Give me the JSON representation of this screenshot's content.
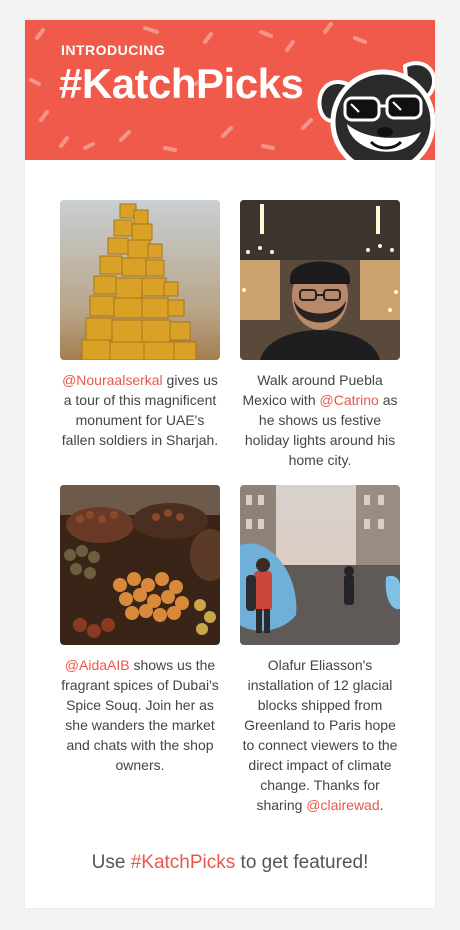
{
  "banner": {
    "eyebrow": "INTRODUCING",
    "headline": "#KatchPicks",
    "background": "#f05a4b",
    "mascot": "sunglasses-dog-mascot"
  },
  "picks": [
    {
      "image": "golden-cube-monument-photo",
      "mention": "@Nouraalserkal",
      "text": " gives us a tour of this magnificent monument for UAE's fallen soldiers in Sharjah."
    },
    {
      "image": "man-with-holiday-lights-photo",
      "before": "Walk around Puebla Mexico with ",
      "mention": "@Catrino",
      "after": " as he shows us festive holiday lights around his home city."
    },
    {
      "image": "spice-souq-photo",
      "mention": "@AidaAIB",
      "text": " shows us the fragrant spices of Dubai's Spice Souq. Join her as she wanders the market and chats with the shop owners."
    },
    {
      "image": "glacial-blocks-paris-photo",
      "before": "Olafur Eliasson's installation of 12 glacial blocks shipped from Greenland to Paris hope to connect viewers to the direct impact of climate change. Thanks for sharing ",
      "mention": "@clairewad",
      "after": "."
    }
  ],
  "cta": {
    "before": "Use ",
    "tag": "#KatchPicks",
    "after": " to get featured!"
  },
  "colors": {
    "accent": "#e8574a",
    "text": "#444444"
  }
}
